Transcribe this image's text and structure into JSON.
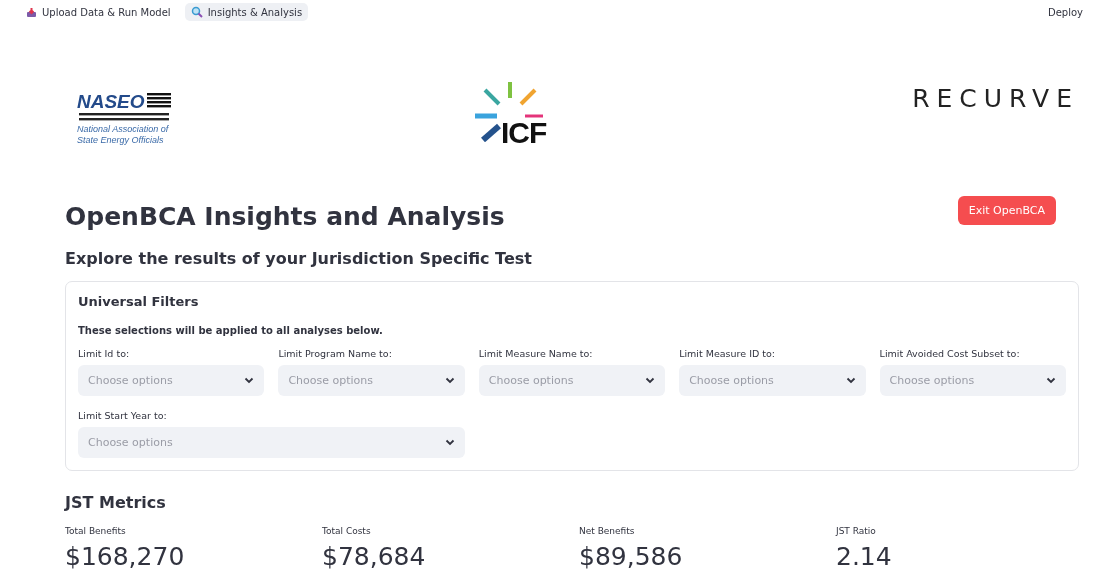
{
  "nav": {
    "pages": [
      {
        "label": "Upload Data & Run Model",
        "kind": "upload",
        "selected": false
      },
      {
        "label": "Insights & Analysis",
        "kind": "search",
        "selected": true
      }
    ],
    "deploy": "Deploy"
  },
  "logos": {
    "naseo": {
      "name": "NASEO",
      "tagline_1": "National Association of",
      "tagline_2": "State Energy Officials"
    },
    "icf": "ICF",
    "recurve": "RECURVE"
  },
  "exit_button": "Exit OpenBCA",
  "title": "OpenBCA Insights and Analysis",
  "subtitle": "Explore the results of your Jurisdiction Specific Test",
  "filters": {
    "title": "Universal Filters",
    "note": "These selections will be applied to all analyses below.",
    "fields": [
      {
        "label": "Limit Id to:",
        "placeholder": "Choose options"
      },
      {
        "label": "Limit Program Name to:",
        "placeholder": "Choose options"
      },
      {
        "label": "Limit Measure Name to:",
        "placeholder": "Choose options"
      },
      {
        "label": "Limit Measure ID to:",
        "placeholder": "Choose options"
      },
      {
        "label": "Limit Avoided Cost Subset to:",
        "placeholder": "Choose options"
      },
      {
        "label": "Limit Start Year to:",
        "placeholder": "Choose options"
      }
    ]
  },
  "metrics": {
    "title": "JST Metrics",
    "items": [
      {
        "label": "Total Benefits",
        "value": "$168,270"
      },
      {
        "label": "Total Costs",
        "value": "$78,684"
      },
      {
        "label": "Net Benefits",
        "value": "$89,586"
      },
      {
        "label": "JST Ratio",
        "value": "2.14"
      }
    ]
  }
}
